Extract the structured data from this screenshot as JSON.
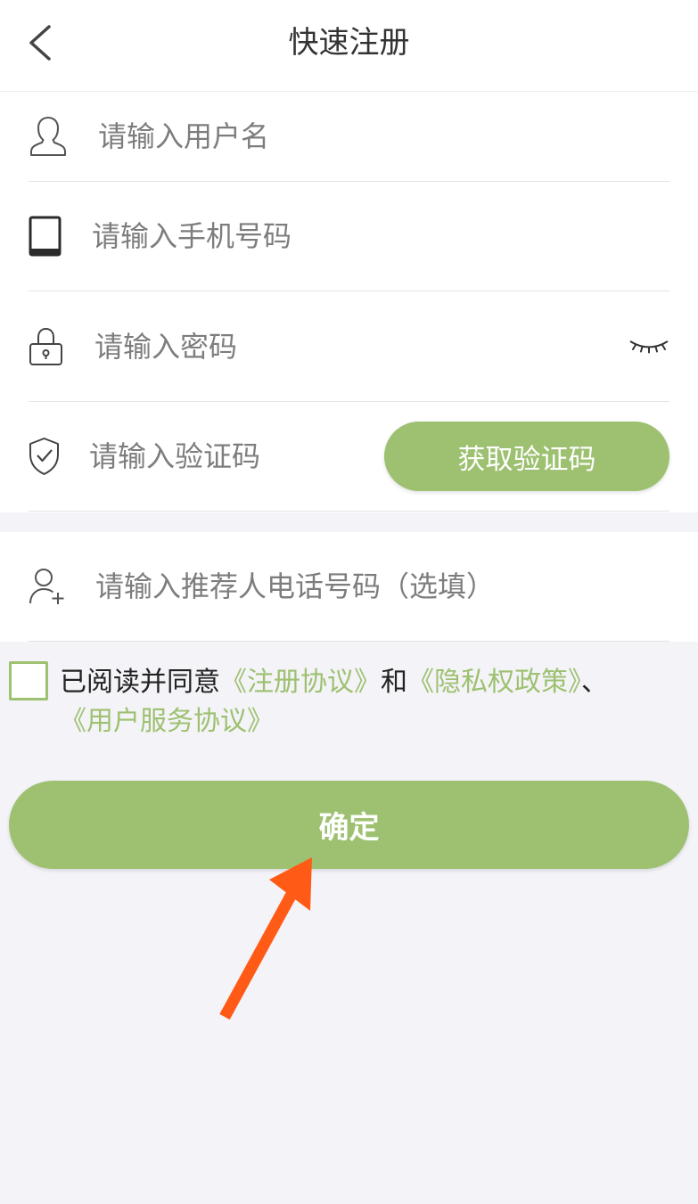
{
  "header": {
    "title": "快速注册",
    "back_icon": "chevron-left-icon"
  },
  "form": {
    "username": {
      "icon": "user-icon",
      "placeholder": "请输入用户名",
      "value": ""
    },
    "phone": {
      "icon": "phone-icon",
      "placeholder": "请输入手机号码",
      "value": ""
    },
    "password": {
      "icon": "lock-icon",
      "placeholder": "请输入密码",
      "value": "",
      "toggle_icon": "eye-closed-icon"
    },
    "verification_code": {
      "icon": "shield-check-icon",
      "placeholder": "请输入验证码",
      "value": "",
      "button_label": "获取验证码"
    },
    "referrer_phone": {
      "icon": "user-add-icon",
      "placeholder": "请输入推荐人电话号码（选填）",
      "value": ""
    }
  },
  "agreement": {
    "checked": false,
    "prefix": "已阅读并同意",
    "link_registration": "《注册协议》",
    "conjunction": "和",
    "link_privacy": "《隐私权政策》",
    "separator": "、",
    "link_service": "《用户服务协议》"
  },
  "submit": {
    "label": "确定"
  },
  "colors": {
    "accent": "#9dc170",
    "background": "#f4f3f8",
    "annotation_arrow": "#ff5b17",
    "text": "#333333",
    "placeholder": "#7d7d7d"
  }
}
